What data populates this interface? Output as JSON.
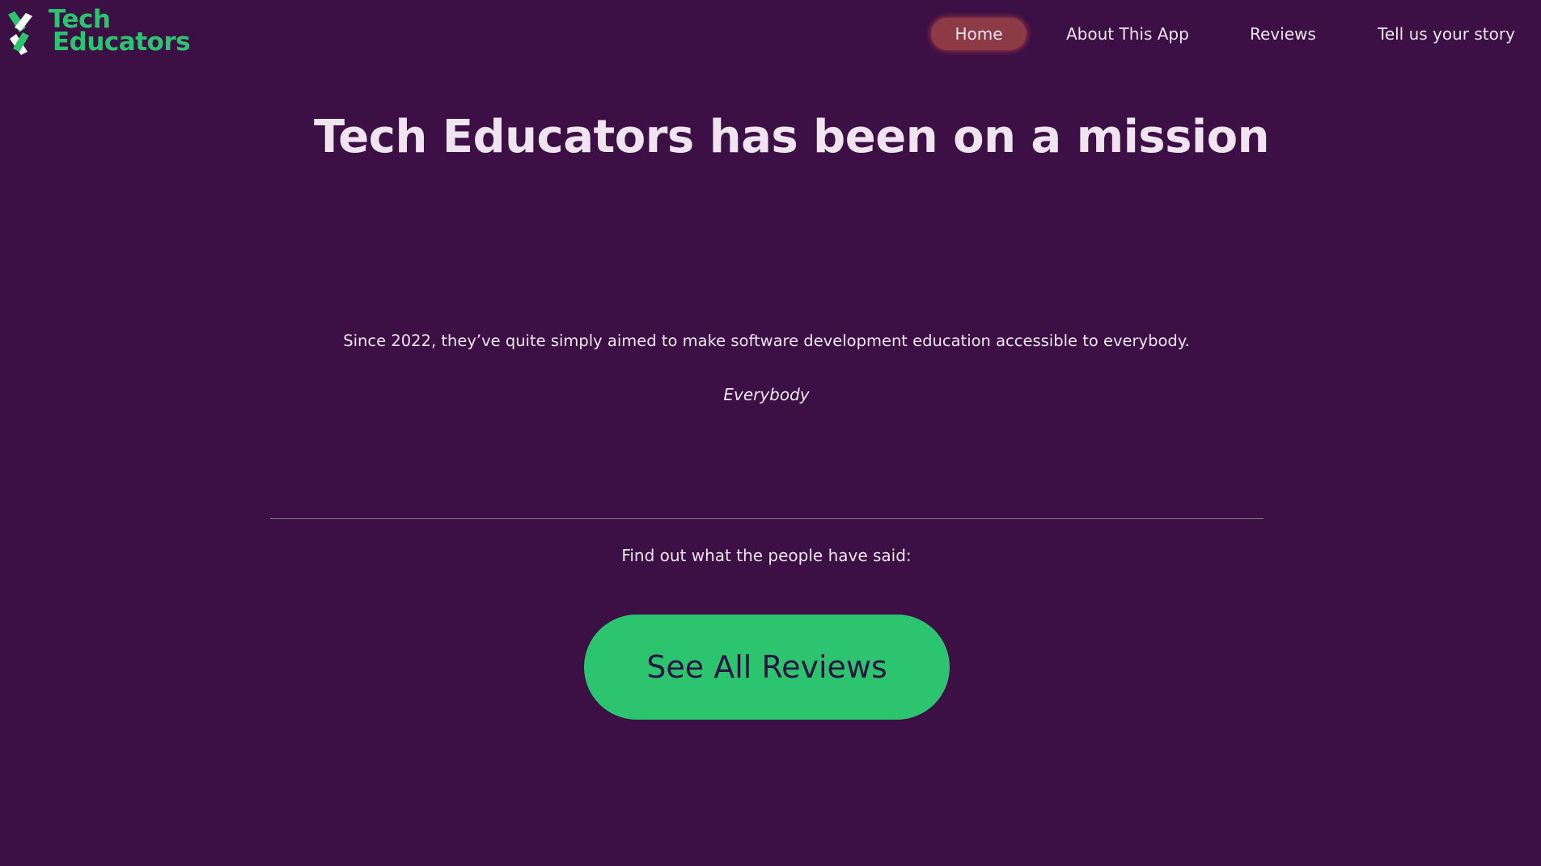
{
  "header": {
    "logo": {
      "line1": "Tech",
      "line2": "Educators",
      "icon": "tech-educators-logo-icon"
    },
    "nav": [
      {
        "label": "Home",
        "active": true
      },
      {
        "label": "About This App",
        "active": false
      },
      {
        "label": "Reviews",
        "active": false
      },
      {
        "label": "Tell us your story",
        "active": false
      }
    ]
  },
  "main": {
    "title": "Tech Educators has been on a mission",
    "intro": "Since 2022, they’ve quite simply aimed to make software development education accessible to everybody.",
    "emphasis": "Everybody",
    "prompt": "Find out what the people have said:",
    "cta_label": "See All Reviews"
  },
  "colors": {
    "background": "#3d1045",
    "accent": "#2cc46f",
    "active_nav": "#8c3a45",
    "text": "#efe4f0"
  }
}
